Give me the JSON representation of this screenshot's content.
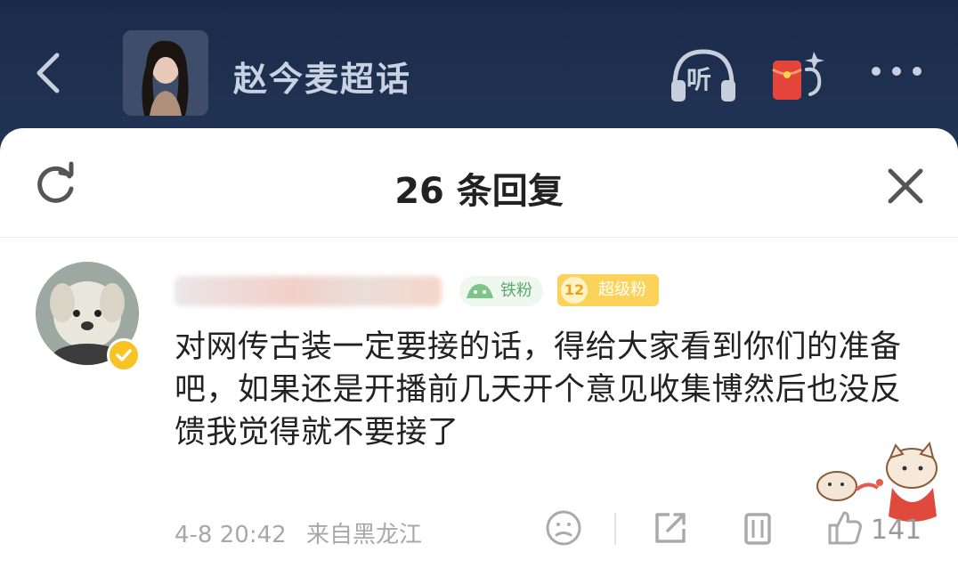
{
  "header": {
    "title": "赵今麦超话",
    "listen_label": "听"
  },
  "sheet": {
    "title": "26 条回复"
  },
  "comment": {
    "fan_badge": "铁粉",
    "level": "12",
    "level_label": "超级粉",
    "text": "对网传古装一定要接的话，得给大家看到你们的准备吧，如果还是开播前几天开个意见收集博然后也没反馈我觉得就不要接了",
    "time": "4-8 20:42",
    "location": "来自黑龙江",
    "like_count": "141"
  },
  "colors": {
    "header_bg": "#1a2a4a",
    "sheet_bg": "#ffffff",
    "verified": "#f7c325",
    "level_badge": "#fbd35a",
    "fan_badge_text": "#5aa86b"
  },
  "icons": {
    "back": "chevron-left-icon",
    "listen": "headphones-icon",
    "redpacket": "red-packet-icon",
    "more": "more-dots-icon",
    "refresh": "refresh-icon",
    "close": "close-icon",
    "emoji": "emoji-icon",
    "share": "share-icon",
    "delete": "trash-icon",
    "like": "thumbs-up-icon"
  }
}
